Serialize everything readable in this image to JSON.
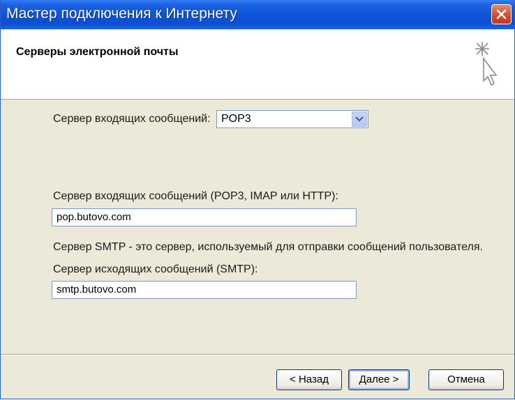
{
  "window": {
    "title": "Мастер подключения к Интернету"
  },
  "header": {
    "title": "Серверы электронной почты"
  },
  "form": {
    "incoming_type_label": "Сервер входящих сообщений:",
    "incoming_type_value": "POP3",
    "incoming_server_label": "Сервер входящих сообщений (POP3, IMAP или HTTP):",
    "incoming_server_value": "pop.butovo.com",
    "smtp_note": "Сервер SMTP - это сервер, используемый для отправки сообщений  пользователя.",
    "outgoing_server_label": "Сервер исходящих сообщений (SMTP):",
    "outgoing_server_value": "smtp.butovo.com"
  },
  "buttons": {
    "back": "< Назад",
    "next": "Далее >",
    "cancel": "Отмена"
  },
  "colors": {
    "titlebar": "#0f55d8",
    "dialog_bg": "#ece9d8",
    "close": "#d6452a"
  },
  "icons": {
    "close": "close-icon",
    "wizard": "wizard-cursor-icon",
    "dropdown": "chevron-down-icon"
  }
}
